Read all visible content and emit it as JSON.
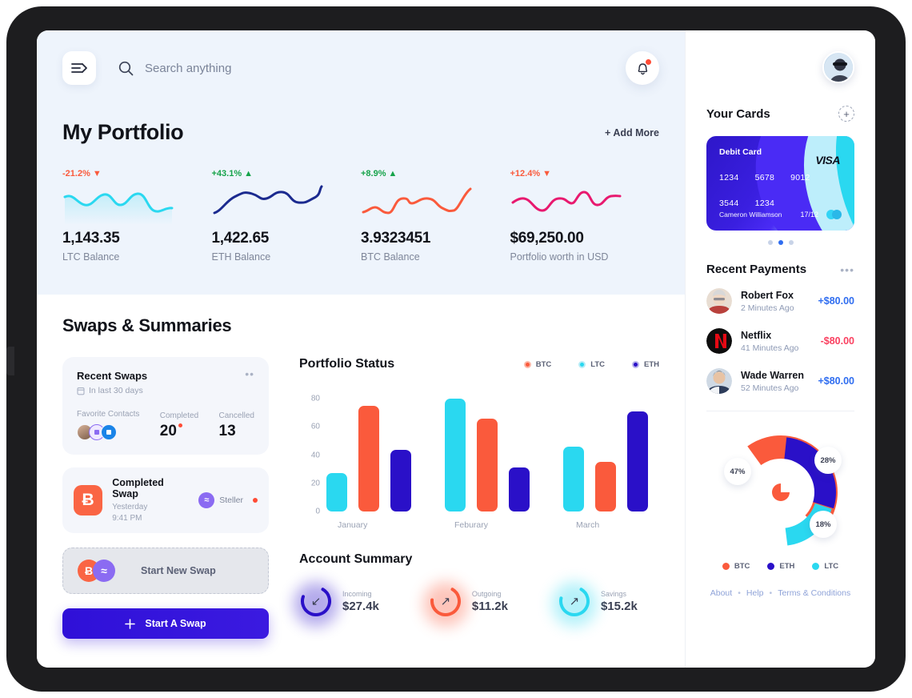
{
  "topbar": {
    "menu_icon": "menu-expand-icon",
    "search_icon": "search-icon",
    "search_placeholder": "Search anything",
    "search_value": "",
    "bell_icon": "bell-icon"
  },
  "portfolio": {
    "title": "My Portfolio",
    "add_more": "+ Add More",
    "stats": [
      {
        "change": "-21.2%",
        "arrow": "▼",
        "dir": "down",
        "value": "1,143.35",
        "label": "LTC Balance",
        "color": "#2ad8f0"
      },
      {
        "change": "+43.1%",
        "arrow": "▲",
        "dir": "up",
        "value": "1,422.65",
        "label": "ETH Balance",
        "color": "#1b2a8f"
      },
      {
        "change": "+8.9%",
        "arrow": "▲",
        "dir": "up",
        "value": "3.9323451",
        "label": "BTC Balance",
        "color": "#fa6544"
      },
      {
        "change": "+12.4%",
        "arrow": "▼",
        "dir": "down",
        "value": "$69,250.00",
        "label": "Portfolio worth in USD",
        "color": "#e8196f"
      }
    ]
  },
  "swaps": {
    "section_title": "Swaps & Summaries",
    "recent": {
      "title": "Recent Swaps",
      "subtitle": "In last 30 days",
      "calendar_icon": "calendar-icon",
      "more_icon": "more-dots-icon",
      "contacts_label": "Favorite Contacts",
      "completed_label": "Completed",
      "completed_value": "20",
      "cancelled_label": "Cancelled",
      "cancelled_value": "13"
    },
    "completed_swap": {
      "coin_symbol": "Ƀ",
      "title": "Completed Swap",
      "time": "Yesterday 9:41 PM",
      "partner": "Steller",
      "partner_symbol": "≈"
    },
    "start_new": {
      "label": "Start New Swap",
      "coin_a": "Ƀ",
      "coin_b": "≈"
    },
    "start_button": "Start A Swap",
    "plus_icon": "plus-icon"
  },
  "chart_data": {
    "type": "bar",
    "title": "Portfolio Status",
    "categories": [
      "January",
      "Feburary",
      "March"
    ],
    "series": [
      {
        "name": "LTC",
        "color": "#2ad8f0",
        "values": [
          27,
          80,
          46
        ]
      },
      {
        "name": "BTC",
        "color": "#fa5a3c",
        "values": [
          75,
          66,
          35
        ]
      },
      {
        "name": "ETH",
        "color": "#2a10c8",
        "values": [
          44,
          31,
          71
        ]
      }
    ],
    "legend": [
      "BTC",
      "LTC",
      "ETH"
    ],
    "legend_colors": {
      "BTC": "#fa5a3c",
      "LTC": "#2ad8f0",
      "ETH": "#2a10c8"
    },
    "legend_position": "top-right",
    "yticks": [
      80,
      60,
      40,
      20,
      0
    ],
    "ylim": [
      0,
      88
    ],
    "xlabel": "",
    "ylabel": "",
    "grid": false
  },
  "account_summary": {
    "title": "Account Summary",
    "items": [
      {
        "label": "Incoming",
        "value": "$27.4k",
        "arrow": "↙",
        "color": "#2a10c8",
        "pct": 72
      },
      {
        "label": "Outgoing",
        "value": "$11.2k",
        "arrow": "↗",
        "color": "#fa5a3c",
        "pct": 68
      },
      {
        "label": "Savings",
        "value": "$15.2k",
        "arrow": "↗",
        "color": "#2ad8f0",
        "pct": 70
      }
    ]
  },
  "sidebar": {
    "avatar_name": "user-avatar",
    "cards": {
      "title": "Your Cards",
      "add_icon": "add-card-icon",
      "card": {
        "type": "Debit Card",
        "brand": "VISA",
        "digits": [
          "1234",
          "5678",
          "9012",
          "3544",
          "1234"
        ],
        "holder": "Cameron Williamson",
        "expiry": "17/12"
      },
      "pager": {
        "count": 3,
        "active": 1
      }
    },
    "payments": {
      "title": "Recent Payments",
      "more_icon": "more-dots-icon",
      "items": [
        {
          "name": "Robert Fox",
          "time": "2 Minutes Ago",
          "amount": "+$80.00",
          "positive": true
        },
        {
          "name": "Netflix",
          "time": "41 Minutes Ago",
          "amount": "-$80.00",
          "positive": false
        },
        {
          "name": "Wade Warren",
          "time": "52 Minutes Ago",
          "amount": "+$80.00",
          "positive": true
        }
      ]
    },
    "donut": {
      "type": "pie",
      "slices": [
        {
          "name": "BTC",
          "value": 47,
          "label": "47%",
          "color": "#fa5a3c"
        },
        {
          "name": "ETH",
          "value": 28,
          "label": "28%",
          "color": "#2a10c8"
        },
        {
          "name": "LTC",
          "value": 18,
          "label": "18%",
          "color": "#2ad8f0"
        }
      ],
      "legend": [
        "BTC",
        "ETH",
        "LTC"
      ]
    },
    "footer": {
      "about": "About",
      "help": "Help",
      "terms": "Terms & Conditions",
      "sep": "•"
    }
  },
  "colors": {
    "accent_blue": "#2f10d8",
    "coral": "#fa5a3c",
    "cyan": "#2ad8f0",
    "green": "#16a34a",
    "red": "#ff4b35",
    "header_bg": "#eef4fc"
  }
}
